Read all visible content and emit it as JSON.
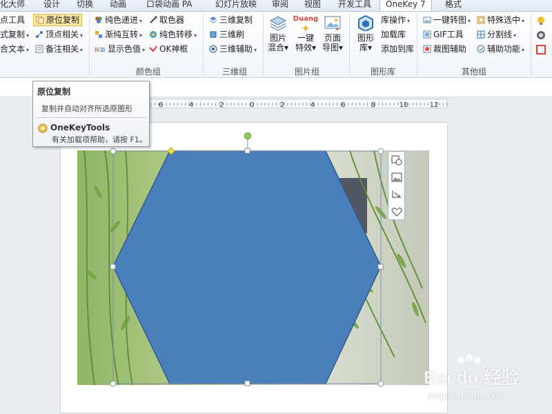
{
  "tabs": [
    {
      "label": "化大师"
    },
    {
      "label": "设计"
    },
    {
      "label": "切换"
    },
    {
      "label": "动画"
    },
    {
      "label": "口袋动画 PA"
    },
    {
      "label": "幻灯片放映"
    },
    {
      "label": "审阅"
    },
    {
      "label": "视图"
    },
    {
      "label": "开发工具"
    },
    {
      "label": "OneKey 7"
    },
    {
      "label": "格式"
    }
  ],
  "ribbon": {
    "group1": {
      "items": [
        "点工具",
        "式复制",
        "合文本"
      ],
      "col2": [
        "原位复制",
        "顶点相关",
        "备注相关"
      ]
    },
    "color_group": {
      "label": "颜色组",
      "col1": [
        "纯色递进",
        "渐纯互转",
        "显示色值"
      ],
      "col2": [
        "取色器",
        "纯色转移",
        "OK神框"
      ]
    },
    "3d_group": {
      "label": "三维组",
      "items": [
        "三维复制",
        "三维刷",
        "三维辅助"
      ]
    },
    "image_group": {
      "label": "图片组",
      "big1": [
        "图片",
        "混合"
      ],
      "big2": [
        "一键",
        "特效"
      ],
      "big3": [
        "页面",
        "导图"
      ],
      "duang": "Duang"
    },
    "shape_lib_group": {
      "label": "图形库",
      "big": [
        "图形",
        "库"
      ],
      "items": [
        "库操作",
        "加载库",
        "添加到库"
      ]
    },
    "other_group": {
      "label": "其他组",
      "col1": [
        "一键转图",
        "GIF工具",
        "裁图辅助"
      ],
      "col2": [
        "特殊选中",
        "分割线",
        "辅助功能"
      ]
    }
  },
  "ruler": {
    "labels": [
      "6",
      "4",
      "2",
      "0",
      "2",
      "4",
      "6",
      "8",
      "10",
      "12"
    ]
  },
  "tooltip": {
    "title": "原位复制",
    "description": "复制并自动对齐所选原图形",
    "brand": "OneKeyTools",
    "help": "有关加载项帮助，请按 F1。"
  },
  "watermark": {
    "text": "Bai du 经验",
    "url": "jingyan.baidu.com"
  },
  "colors": {
    "hexagon_fill": "#4a7fbc",
    "hexagon_stroke": "#2f5a8e",
    "tooltip_border": "#8c95a3",
    "highlight": "#fde9a8",
    "selection_handle": "#8ad05a"
  }
}
